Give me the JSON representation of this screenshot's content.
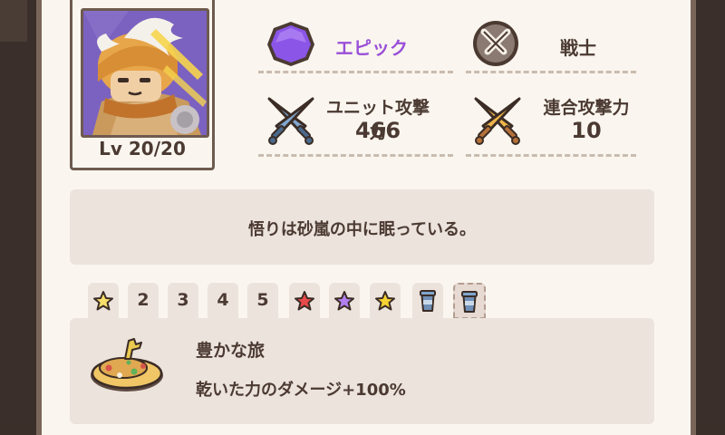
{
  "hero": {
    "level": "Lv 20/20"
  },
  "rarity": {
    "label": "エピック",
    "color": "#9a4fd8",
    "icon": "purple-gem-icon"
  },
  "class": {
    "label": "戦士",
    "icon": "crossed-swords-badge-icon"
  },
  "unit_attack": {
    "label": "ユニット攻撃力",
    "value": "466",
    "icon": "blue-crossed-swords-icon"
  },
  "combo_attack": {
    "label": "連合攻撃力",
    "value": "10",
    "icon": "gold-crossed-swords-icon"
  },
  "quote": "悟りは砂嵐の中に眠っている。",
  "tabs": [
    {
      "label": "",
      "icon": "star-yellow-icon"
    },
    {
      "label": "2"
    },
    {
      "label": "3"
    },
    {
      "label": "4"
    },
    {
      "label": "5"
    },
    {
      "label": "",
      "icon": "star-red-icon"
    },
    {
      "label": "",
      "icon": "star-purple-icon"
    },
    {
      "label": "",
      "icon": "star-gold-icon"
    },
    {
      "label": "",
      "icon": "cup-icon"
    },
    {
      "label": "",
      "icon": "cup-icon",
      "active": true
    }
  ],
  "skill": {
    "name": "豊かな旅",
    "description": "乾いた力のダメージ+100%",
    "icon": "pie-dish-icon"
  }
}
